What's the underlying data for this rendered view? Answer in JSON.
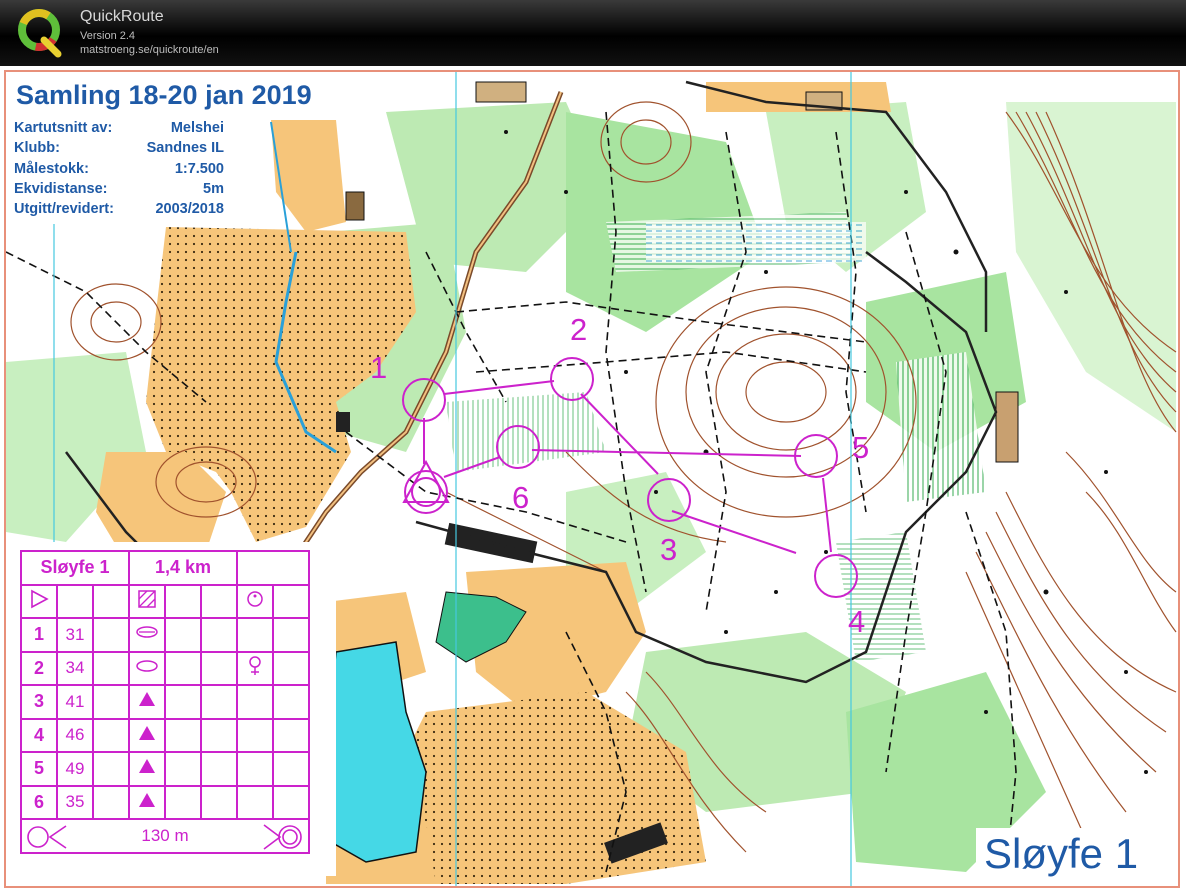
{
  "app": {
    "name": "QuickRoute",
    "version": "Version 2.4",
    "url": "matstroeng.se/quickroute/en"
  },
  "map": {
    "title": "Samling 18-20 jan 2019",
    "info": [
      {
        "label": "Kartutsnitt av:",
        "value": "Melshei"
      },
      {
        "label": "Klubb:",
        "value": "Sandnes IL"
      },
      {
        "label": "Målestokk:",
        "value": "1:7.500"
      },
      {
        "label": "Ekvidistanse:",
        "value": "5m"
      },
      {
        "label": "Utgitt/revidert:",
        "value": "2003/2018"
      }
    ],
    "loop_label": "Sløyfe 1",
    "control_numbers": [
      "1",
      "2",
      "3",
      "4",
      "5",
      "6"
    ],
    "colors": {
      "overprint": "#cc22cc",
      "text_blue": "#1f5aa6",
      "open_land": "#f6c57a",
      "forest_green": "#a8e4a0",
      "water": "#45d8e6",
      "contour": "#a0522d"
    }
  },
  "description": {
    "name": "Sløyfe 1",
    "length": "1,4 km",
    "rows": [
      {
        "num": "1",
        "code": "31",
        "symbol": "knoll-elongated-icon"
      },
      {
        "num": "2",
        "code": "34",
        "symbol": "knoll-oval-icon"
      },
      {
        "num": "3",
        "code": "41",
        "symbol": "boulder-triangle-icon"
      },
      {
        "num": "4",
        "code": "46",
        "symbol": "boulder-triangle-icon"
      },
      {
        "num": "5",
        "code": "49",
        "symbol": "boulder-triangle-icon"
      },
      {
        "num": "6",
        "code": "35",
        "symbol": "boulder-triangle-icon"
      }
    ],
    "finish_distance": "130 m"
  }
}
